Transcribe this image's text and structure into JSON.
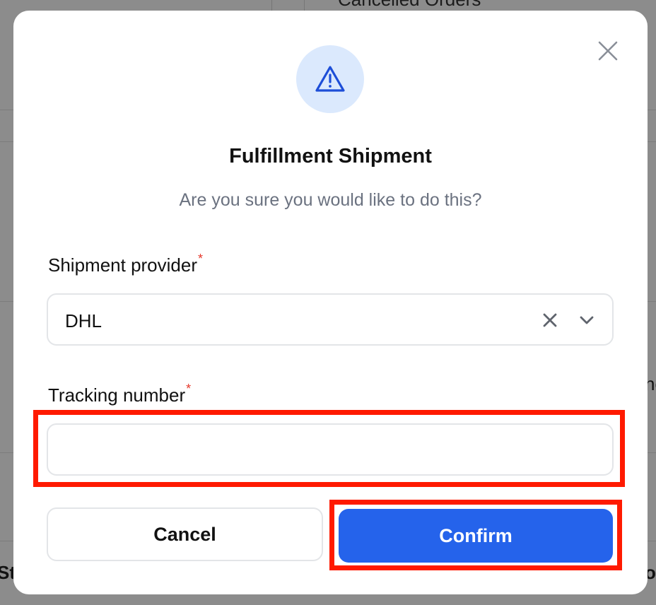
{
  "background": {
    "top_text": "Cancelled Orders",
    "left_fragment": "St",
    "right_fragment_mid": "ne",
    "right_fragment_bottom": "o"
  },
  "modal": {
    "close_icon": "close-icon",
    "warning_icon": "warning-triangle-icon",
    "title": "Fulfillment Shipment",
    "subtitle": "Are you sure you would like to do this?",
    "provider": {
      "label": "Shipment provider",
      "required_mark": "*",
      "value": "DHL",
      "clear_icon": "clear-icon",
      "dropdown_icon": "chevron-down-icon"
    },
    "tracking": {
      "label": "Tracking number",
      "required_mark": "*",
      "value": "",
      "placeholder": ""
    },
    "cancel_label": "Cancel",
    "confirm_label": "Confirm"
  },
  "colors": {
    "primary": "#2563eb",
    "warning_circle": "#dbe9fd",
    "highlight": "#ff1a00",
    "required": "#e5372b"
  }
}
